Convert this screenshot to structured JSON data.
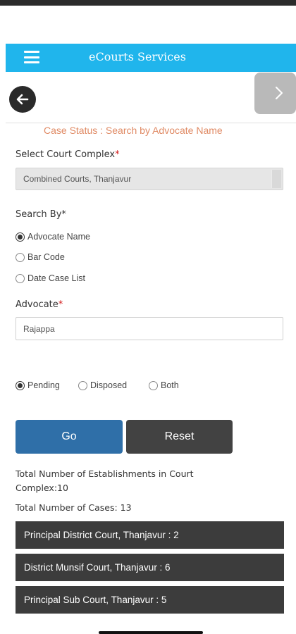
{
  "header": {
    "title": "eCourts Services"
  },
  "icons": {
    "menu": "hamburger-menu-icon",
    "back": "arrow-left-icon",
    "forward": "chevron-right-icon"
  },
  "colors": {
    "app_bar": "#20b5ec",
    "title_accent": "#e08a64",
    "go_button": "#2f6fa8",
    "reset_button": "#424242",
    "court_item": "#3c3c3c",
    "required": "#d21b1b"
  },
  "page": {
    "title": "Case Status : Search by Advocate Name"
  },
  "court_complex": {
    "label": "Select Court Complex",
    "required_mark": "*",
    "selected": "Combined Courts, Thanjavur"
  },
  "search_by": {
    "label": "Search By",
    "required_mark": "*",
    "options": [
      "Advocate Name",
      "Bar Code",
      "Date Case List"
    ],
    "selected": "Advocate Name"
  },
  "advocate": {
    "label": "Advocate",
    "required_mark": "*",
    "value": "Rajappa"
  },
  "status_filter": {
    "options": [
      "Pending",
      "Disposed",
      "Both"
    ],
    "selected": "Pending"
  },
  "buttons": {
    "go": "Go",
    "reset": "Reset"
  },
  "results": {
    "establishments_line1": "Total Number of Establishments in Court",
    "establishments_line2": "Complex:10",
    "total_cases": "Total Number of Cases: 13",
    "courts": [
      "Principal District Court, Thanjavur : 2",
      "District Munsif Court, Thanjavur : 6",
      "Principal Sub Court, Thanjavur : 5"
    ]
  }
}
